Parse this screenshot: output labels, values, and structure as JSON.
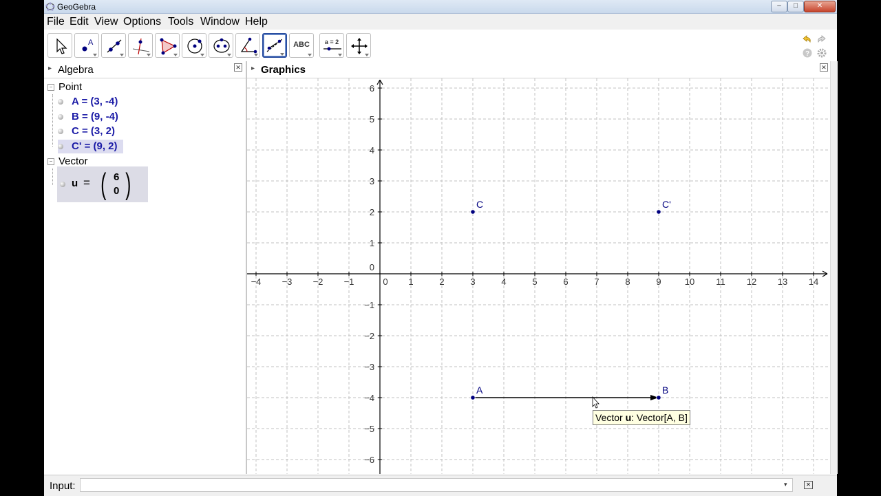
{
  "window": {
    "title": "GeoGebra",
    "minimize": "–",
    "maximize": "□",
    "close": "✕"
  },
  "menu": [
    "File",
    "Edit",
    "View",
    "Options",
    "Tools",
    "Window",
    "Help"
  ],
  "toolbar": {
    "tools": [
      {
        "name": "move-tool",
        "icon": "cursor-arrow-icon"
      },
      {
        "name": "point-tool",
        "icon": "point-icon",
        "label": "A"
      },
      {
        "name": "line-tool",
        "icon": "line-icon"
      },
      {
        "name": "perpendicular-tool",
        "icon": "perpendicular-icon"
      },
      {
        "name": "polygon-tool",
        "icon": "polygon-icon"
      },
      {
        "name": "circle-tool",
        "icon": "circle-icon"
      },
      {
        "name": "conic-tool",
        "icon": "ellipse-icon"
      },
      {
        "name": "angle-tool",
        "icon": "angle-icon"
      },
      {
        "name": "reflect-tool",
        "icon": "reflect-icon",
        "selected": true
      },
      {
        "name": "text-tool",
        "icon": "text-icon",
        "label": "ABC"
      },
      {
        "name": "slider-tool",
        "icon": "slider-icon",
        "label": "a = 2"
      },
      {
        "name": "move-graphics-tool",
        "icon": "move-arrows-icon"
      }
    ]
  },
  "algebra": {
    "title": "Algebra",
    "groups": [
      {
        "name": "Point",
        "items": [
          {
            "expr": "A = (3, -4)",
            "highlighted": false
          },
          {
            "expr": "B = (9, -4)",
            "highlighted": false
          },
          {
            "expr": "C = (3, 2)",
            "highlighted": false
          },
          {
            "expr": "C' = (9, 2)",
            "highlighted": true
          }
        ]
      },
      {
        "name": "Vector",
        "vector": {
          "name": "u",
          "eq": "=",
          "x": "6",
          "y": "0"
        }
      }
    ]
  },
  "graphics": {
    "title": "Graphics",
    "axes": {
      "x_ticks": [
        "−4",
        "−3",
        "−2",
        "−1",
        "0",
        "1",
        "2",
        "3",
        "4",
        "5",
        "6",
        "7",
        "8",
        "9",
        "10",
        "11",
        "12",
        "13",
        "14"
      ],
      "y_ticks": [
        "6",
        "5",
        "4",
        "3",
        "2",
        "1",
        "0",
        "−1",
        "−2",
        "−3",
        "−4",
        "−5",
        "−6"
      ]
    },
    "points": [
      {
        "label": "C",
        "x": 3,
        "y": 2
      },
      {
        "label": "C'",
        "x": 9,
        "y": 2
      },
      {
        "label": "A",
        "x": 3,
        "y": -4
      },
      {
        "label": "B",
        "x": 9,
        "y": -4
      }
    ],
    "vector": {
      "from": "A",
      "to": "B"
    },
    "point_color": "#00007f",
    "tooltip": {
      "prefix": "Vector ",
      "name": "u",
      "suffix": ": Vector[A, B]"
    }
  },
  "input": {
    "label": "Input:",
    "value": "",
    "placeholder": ""
  },
  "colors": {
    "selected_tool_border": "#2a4ea0",
    "algebra_item_text": "#1a1aa6",
    "highlight": "#dcdcf0",
    "tooltip_bg": "#ffffe1"
  }
}
